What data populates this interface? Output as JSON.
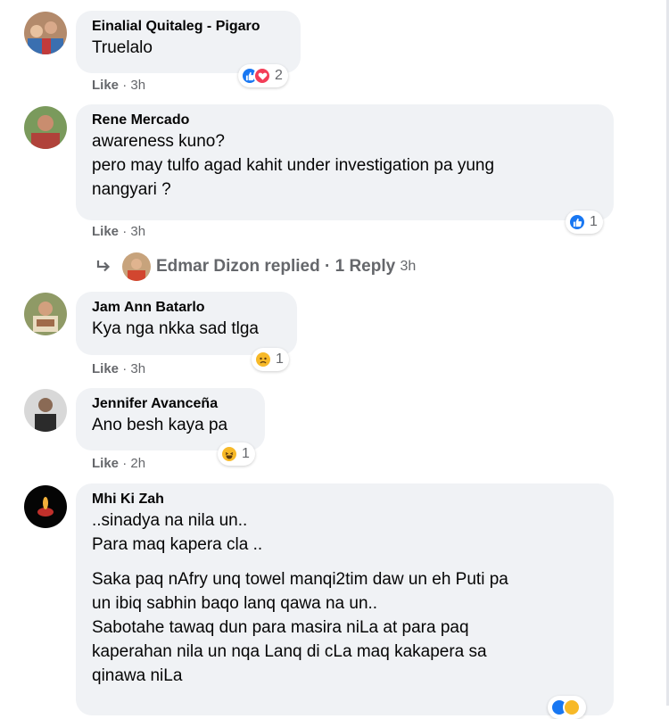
{
  "comments": [
    {
      "author": "Einalial Quitaleg - Pigaro",
      "lines": [
        "Truelalo"
      ],
      "like_label": "Like",
      "time": "3h",
      "reaction_count": "2",
      "reaction_icons": [
        "like-icon",
        "love-icon"
      ]
    },
    {
      "author": "Rene Mercado",
      "lines": [
        "awareness kuno?",
        "pero may tulfo agad kahit under investigation pa yung",
        "nangyari ?"
      ],
      "like_label": "Like",
      "time": "3h",
      "reaction_count": "1",
      "reaction_icons": [
        "like-icon"
      ],
      "reply": {
        "replier": "Edmar Dizon",
        "replied_label": "replied",
        "separator": "·",
        "replies_label": "1 Reply",
        "time": "3h"
      }
    },
    {
      "author": "Jam Ann Batarlo",
      "lines": [
        "Kya nga nkka sad tlga"
      ],
      "like_label": "Like",
      "time": "3h",
      "reaction_count": "1",
      "reaction_icons": [
        "sad-icon"
      ]
    },
    {
      "author": "Jennifer Avanceña",
      "lines": [
        "Ano besh kaya pa"
      ],
      "like_label": "Like",
      "time": "2h",
      "reaction_count": "1",
      "reaction_icons": [
        "haha-icon"
      ]
    },
    {
      "author": "Mhi Ki Zah",
      "lines": [
        "..sinadya na nila un..",
        "Para maq kapera cla ..",
        "Saka paq nAfry unq towel manqi2tim daw un eh Puti pa",
        "un ibiq sabhin baqo lanq qawa na un..",
        "Sabotahe tawaq dun para masira niLa at para paq",
        "kaperahan nila un nqa Lanq di cLa maq kakapera sa",
        "qinawa niLa"
      ]
    }
  ],
  "meta_separator": "·",
  "colors": {
    "bubble": "#f0f2f5",
    "meta_text": "#65676b",
    "like_blue": "#1877f2",
    "love_red": "#f33e58",
    "emoji_yellow": "#f7b928"
  }
}
